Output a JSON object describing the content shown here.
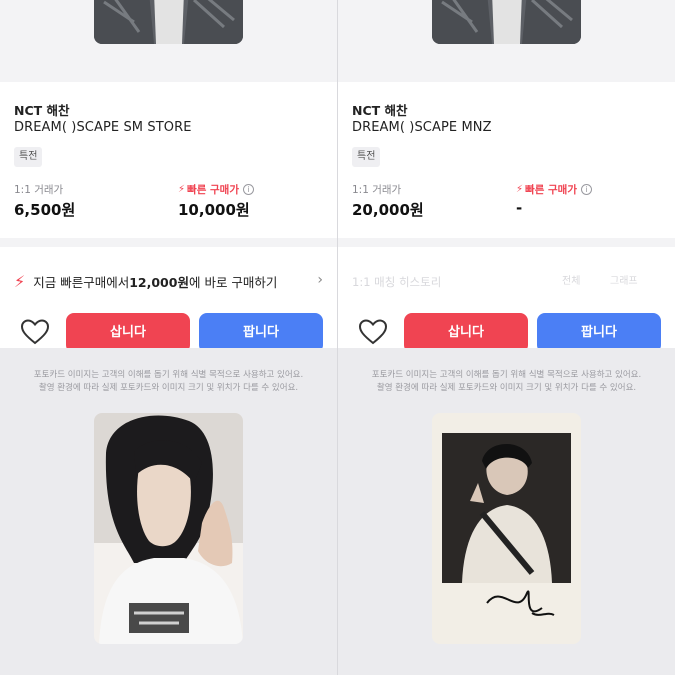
{
  "left": {
    "artist": "NCT 해찬",
    "album": "DREAM( )SCAPE SM STORE",
    "badge": "특전",
    "last_trade_label": "1:1 거래가",
    "last_trade_price": "6,500원",
    "fast_buy_label": "빠른 구매가",
    "fast_buy_price": "10,000원",
    "banner": {
      "prefix": "지금 빠른구매에서 ",
      "amount": "12,000원",
      "suffix": "에 바로 구매하기"
    },
    "buy_label": "삽니다",
    "sell_label": "팝니다",
    "notice_line1": "포토카드 이미지는 고객의 이해를 돕기 위해 식별 목적으로 사용하고 있어요.",
    "notice_line2": "촬영 환경에 따라 실제 포토카드와 이미지 크기 및 위치가 다를 수 있어요."
  },
  "right": {
    "artist": "NCT 해찬",
    "album": "DREAM( )SCAPE MNZ",
    "badge": "특전",
    "last_trade_label": "1:1 거래가",
    "last_trade_price": "20,000원",
    "fast_buy_label": "빠른 구매가",
    "fast_buy_price": "-",
    "history_label": "1:1 매칭 히스토리",
    "chip1": "전체",
    "chip2": "그래프",
    "buy_label": "삽니다",
    "sell_label": "팝니다",
    "notice_line1": "포토카드 이미지는 고객의 이해를 돕기 위해 식별 목적으로 사용하고 있어요.",
    "notice_line2": "촬영 환경에 따라 실제 포토카드와 이미지 크기 및 위치가 다를 수 있어요."
  },
  "colors": {
    "accent_red": "#f04452",
    "accent_blue": "#4b7ff5"
  },
  "icons": [
    "bolt-icon",
    "info-icon",
    "chevron-right-icon",
    "heart-icon"
  ]
}
